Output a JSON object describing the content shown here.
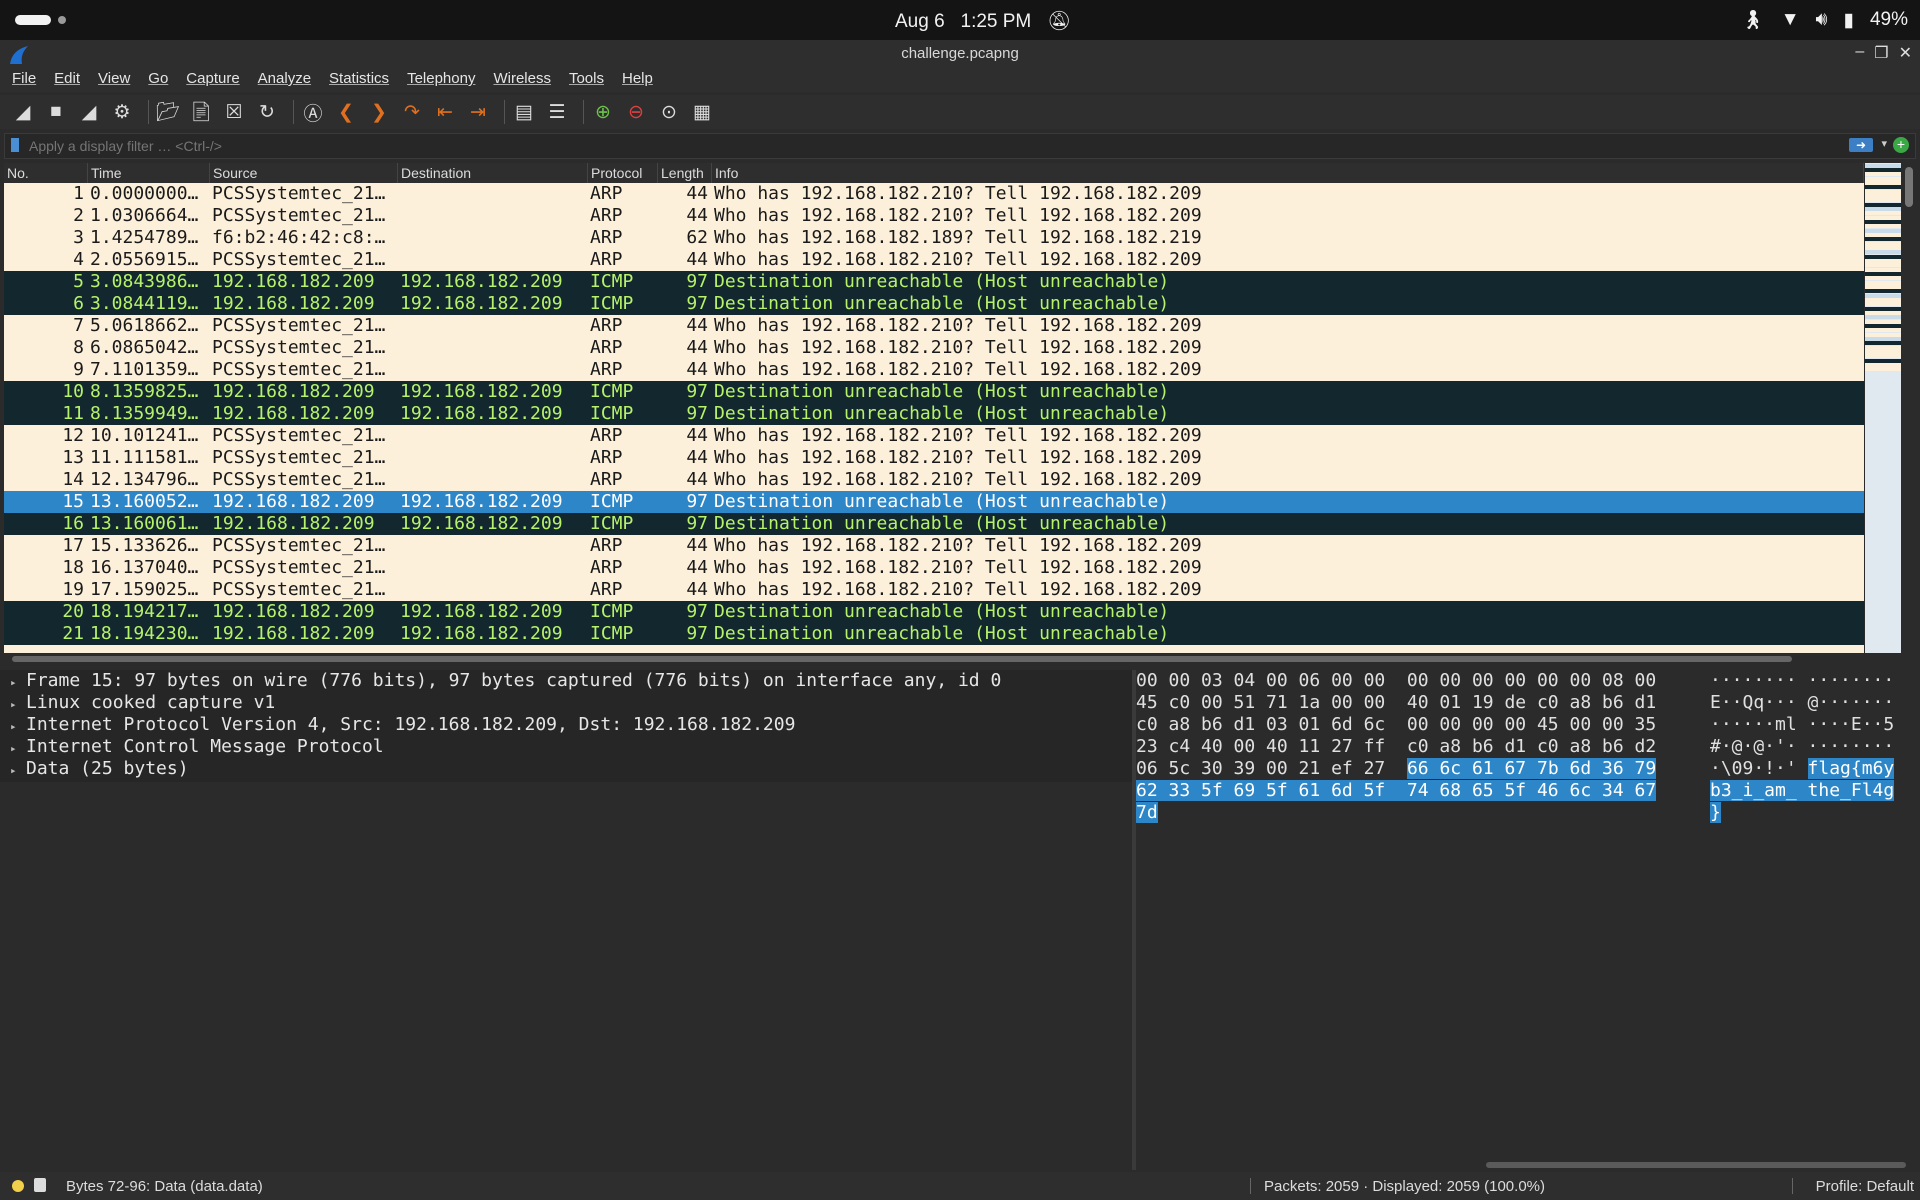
{
  "topbar": {
    "date": "Aug 6",
    "time": "1:25 PM",
    "battery": "49%"
  },
  "window": {
    "title": "challenge.pcapng"
  },
  "menu": [
    "File",
    "Edit",
    "View",
    "Go",
    "Capture",
    "Analyze",
    "Statistics",
    "Telephony",
    "Wireless",
    "Tools",
    "Help"
  ],
  "filter": {
    "placeholder": "Apply a display filter … <Ctrl-/>"
  },
  "packet_list": {
    "columns": [
      "No.",
      "Time",
      "Source",
      "Destination",
      "Protocol",
      "Length",
      "Info"
    ],
    "rows": [
      {
        "no": "1",
        "time": "0.0000000…",
        "src": "PCSSystemtec_21…",
        "dst": "",
        "proto": "ARP",
        "len": "44",
        "info": "Who has 192.168.182.210? Tell 192.168.182.209",
        "kind": "arp"
      },
      {
        "no": "2",
        "time": "1.0306664…",
        "src": "PCSSystemtec_21…",
        "dst": "",
        "proto": "ARP",
        "len": "44",
        "info": "Who has 192.168.182.210? Tell 192.168.182.209",
        "kind": "arp"
      },
      {
        "no": "3",
        "time": "1.4254789…",
        "src": "f6:b2:46:42:c8:…",
        "dst": "",
        "proto": "ARP",
        "len": "62",
        "info": "Who has 192.168.182.189? Tell 192.168.182.219",
        "kind": "arp"
      },
      {
        "no": "4",
        "time": "2.0556915…",
        "src": "PCSSystemtec_21…",
        "dst": "",
        "proto": "ARP",
        "len": "44",
        "info": "Who has 192.168.182.210? Tell 192.168.182.209",
        "kind": "arp"
      },
      {
        "no": "5",
        "time": "3.0843986…",
        "src": "192.168.182.209",
        "dst": "192.168.182.209",
        "proto": "ICMP",
        "len": "97",
        "info": "Destination unreachable (Host unreachable)",
        "kind": "icmp"
      },
      {
        "no": "6",
        "time": "3.0844119…",
        "src": "192.168.182.209",
        "dst": "192.168.182.209",
        "proto": "ICMP",
        "len": "97",
        "info": "Destination unreachable (Host unreachable)",
        "kind": "icmp"
      },
      {
        "no": "7",
        "time": "5.0618662…",
        "src": "PCSSystemtec_21…",
        "dst": "",
        "proto": "ARP",
        "len": "44",
        "info": "Who has 192.168.182.210? Tell 192.168.182.209",
        "kind": "arp"
      },
      {
        "no": "8",
        "time": "6.0865042…",
        "src": "PCSSystemtec_21…",
        "dst": "",
        "proto": "ARP",
        "len": "44",
        "info": "Who has 192.168.182.210? Tell 192.168.182.209",
        "kind": "arp"
      },
      {
        "no": "9",
        "time": "7.1101359…",
        "src": "PCSSystemtec_21…",
        "dst": "",
        "proto": "ARP",
        "len": "44",
        "info": "Who has 192.168.182.210? Tell 192.168.182.209",
        "kind": "arp"
      },
      {
        "no": "10",
        "time": "8.1359825…",
        "src": "192.168.182.209",
        "dst": "192.168.182.209",
        "proto": "ICMP",
        "len": "97",
        "info": "Destination unreachable (Host unreachable)",
        "kind": "icmp"
      },
      {
        "no": "11",
        "time": "8.1359949…",
        "src": "192.168.182.209",
        "dst": "192.168.182.209",
        "proto": "ICMP",
        "len": "97",
        "info": "Destination unreachable (Host unreachable)",
        "kind": "icmp"
      },
      {
        "no": "12",
        "time": "10.101241…",
        "src": "PCSSystemtec_21…",
        "dst": "",
        "proto": "ARP",
        "len": "44",
        "info": "Who has 192.168.182.210? Tell 192.168.182.209",
        "kind": "arp"
      },
      {
        "no": "13",
        "time": "11.111581…",
        "src": "PCSSystemtec_21…",
        "dst": "",
        "proto": "ARP",
        "len": "44",
        "info": "Who has 192.168.182.210? Tell 192.168.182.209",
        "kind": "arp"
      },
      {
        "no": "14",
        "time": "12.134796…",
        "src": "PCSSystemtec_21…",
        "dst": "",
        "proto": "ARP",
        "len": "44",
        "info": "Who has 192.168.182.210? Tell 192.168.182.209",
        "kind": "arp"
      },
      {
        "no": "15",
        "time": "13.160052…",
        "src": "192.168.182.209",
        "dst": "192.168.182.209",
        "proto": "ICMP",
        "len": "97",
        "info": "Destination unreachable (Host unreachable)",
        "kind": "selected"
      },
      {
        "no": "16",
        "time": "13.160061…",
        "src": "192.168.182.209",
        "dst": "192.168.182.209",
        "proto": "ICMP",
        "len": "97",
        "info": "Destination unreachable (Host unreachable)",
        "kind": "icmp"
      },
      {
        "no": "17",
        "time": "15.133626…",
        "src": "PCSSystemtec_21…",
        "dst": "",
        "proto": "ARP",
        "len": "44",
        "info": "Who has 192.168.182.210? Tell 192.168.182.209",
        "kind": "arp"
      },
      {
        "no": "18",
        "time": "16.137040…",
        "src": "PCSSystemtec_21…",
        "dst": "",
        "proto": "ARP",
        "len": "44",
        "info": "Who has 192.168.182.210? Tell 192.168.182.209",
        "kind": "arp"
      },
      {
        "no": "19",
        "time": "17.159025…",
        "src": "PCSSystemtec_21…",
        "dst": "",
        "proto": "ARP",
        "len": "44",
        "info": "Who has 192.168.182.210? Tell 192.168.182.209",
        "kind": "arp"
      },
      {
        "no": "20",
        "time": "18.194217…",
        "src": "192.168.182.209",
        "dst": "192.168.182.209",
        "proto": "ICMP",
        "len": "97",
        "info": "Destination unreachable (Host unreachable)",
        "kind": "icmp"
      },
      {
        "no": "21",
        "time": "18.194230…",
        "src": "192.168.182.209",
        "dst": "192.168.182.209",
        "proto": "ICMP",
        "len": "97",
        "info": "Destination unreachable (Host unreachable)",
        "kind": "icmp"
      }
    ]
  },
  "details": [
    "Frame 15: 97 bytes on wire (776 bits), 97 bytes captured (776 bits) on interface any, id 0",
    "Linux cooked capture v1",
    "Internet Protocol Version 4, Src: 192.168.182.209, Dst: 192.168.182.209",
    "Internet Control Message Protocol",
    "Data (25 bytes)"
  ],
  "bytes": [
    {
      "hex_a": "00 00 03 04 00 06 00 00  00 00 00 00 00 00 08 00",
      "hl_hex": "",
      "hex_b": "",
      "asc_a": "········ ········",
      "hl_asc": "",
      "asc_b": ""
    },
    {
      "hex_a": "45 c0 00 51 71 1a 00 00  40 01 19 de c0 a8 b6 d1",
      "hl_hex": "",
      "hex_b": "",
      "asc_a": "E··Qq··· @·······",
      "hl_asc": "",
      "asc_b": ""
    },
    {
      "hex_a": "c0 a8 b6 d1 03 01 6d 6c  00 00 00 00 45 00 00 35",
      "hl_hex": "",
      "hex_b": "",
      "asc_a": "······ml ····E··5",
      "hl_asc": "",
      "asc_b": ""
    },
    {
      "hex_a": "23 c4 40 00 40 11 27 ff  c0 a8 b6 d1 c0 a8 b6 d2",
      "hl_hex": "",
      "hex_b": "",
      "asc_a": "#·@·@·'· ········",
      "hl_asc": "",
      "asc_b": ""
    },
    {
      "hex_a": "06 5c 30 39 00 21 ef 27  ",
      "hl_hex": "66 6c 61 67 7b 6d 36 79",
      "hex_b": "",
      "asc_a": "·\\09·!·' ",
      "hl_asc": "flag{m6y",
      "asc_b": ""
    },
    {
      "hex_a": "",
      "hl_hex": "62 33 5f 69 5f 61 6d 5f  74 68 65 5f 46 6c 34 67",
      "hex_b": "",
      "asc_a": "",
      "hl_asc": "b3_i_am_ the_Fl4g",
      "asc_b": ""
    },
    {
      "hex_a": "",
      "hl_hex": "7d",
      "hex_b": "",
      "asc_a": "",
      "hl_asc": "}",
      "asc_b": ""
    }
  ],
  "status": {
    "left": "Bytes 72-96: Data (data.data)",
    "packets": "Packets: 2059 · Displayed: 2059 (100.0%)",
    "profile": "Profile: Default"
  }
}
